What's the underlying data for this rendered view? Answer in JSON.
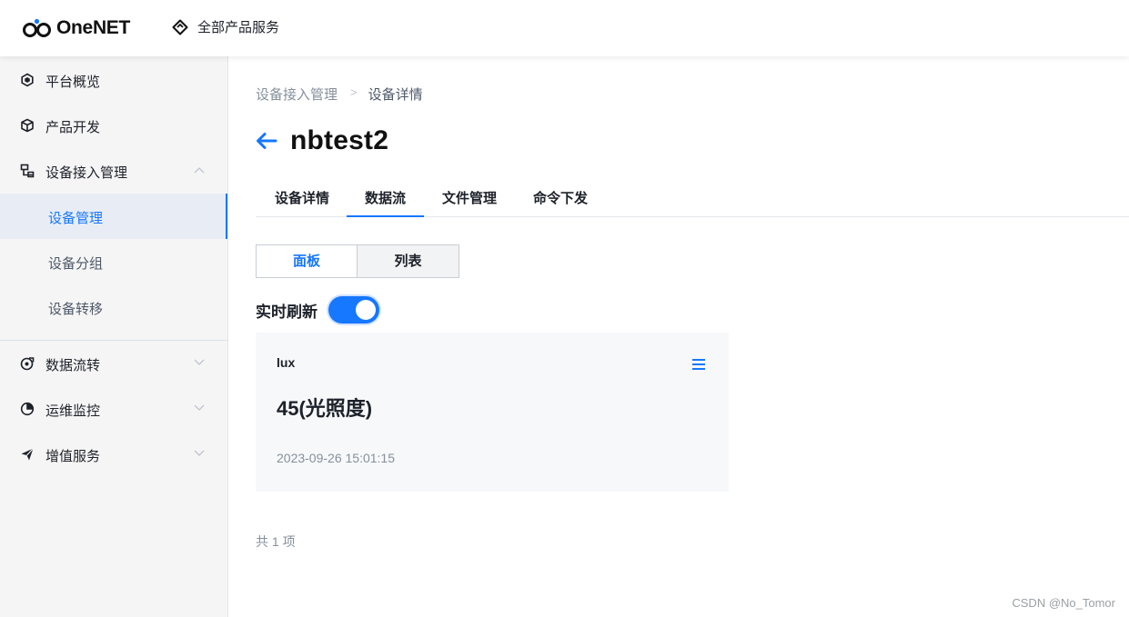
{
  "header": {
    "logo_text": "OneNET",
    "all_products_label": "全部产品服务",
    "brand_color": "#1677ff"
  },
  "sidebar": {
    "items": [
      {
        "label": "平台概览",
        "icon": "hexagon-icon"
      },
      {
        "label": "产品开发",
        "icon": "cube-icon"
      },
      {
        "label": "设备接入管理",
        "icon": "device-access-icon",
        "expanded": true,
        "children": [
          {
            "label": "设备管理",
            "active": true
          },
          {
            "label": "设备分组"
          },
          {
            "label": "设备转移"
          }
        ]
      },
      {
        "label": "数据流转",
        "icon": "data-flow-icon"
      },
      {
        "label": "运维监控",
        "icon": "pie-chart-icon"
      },
      {
        "label": "增值服务",
        "icon": "send-icon"
      }
    ]
  },
  "breadcrumb": {
    "parent": "设备接入管理",
    "separator": ">",
    "current": "设备详情"
  },
  "page": {
    "title": "nbtest2"
  },
  "tabs": [
    {
      "label": "设备详情"
    },
    {
      "label": "数据流",
      "active": true
    },
    {
      "label": "文件管理"
    },
    {
      "label": "命令下发"
    }
  ],
  "view_toggle": {
    "panel_label": "面板",
    "list_label": "列表",
    "selected": "面板"
  },
  "refresh": {
    "label": "实时刷新",
    "enabled": true
  },
  "datastream_card": {
    "name": "lux",
    "value": "45(光照度)",
    "timestamp": "2023-09-26 15:01:15"
  },
  "footer": {
    "total": "共 1 项",
    "watermark": "CSDN @No_Tomor"
  }
}
